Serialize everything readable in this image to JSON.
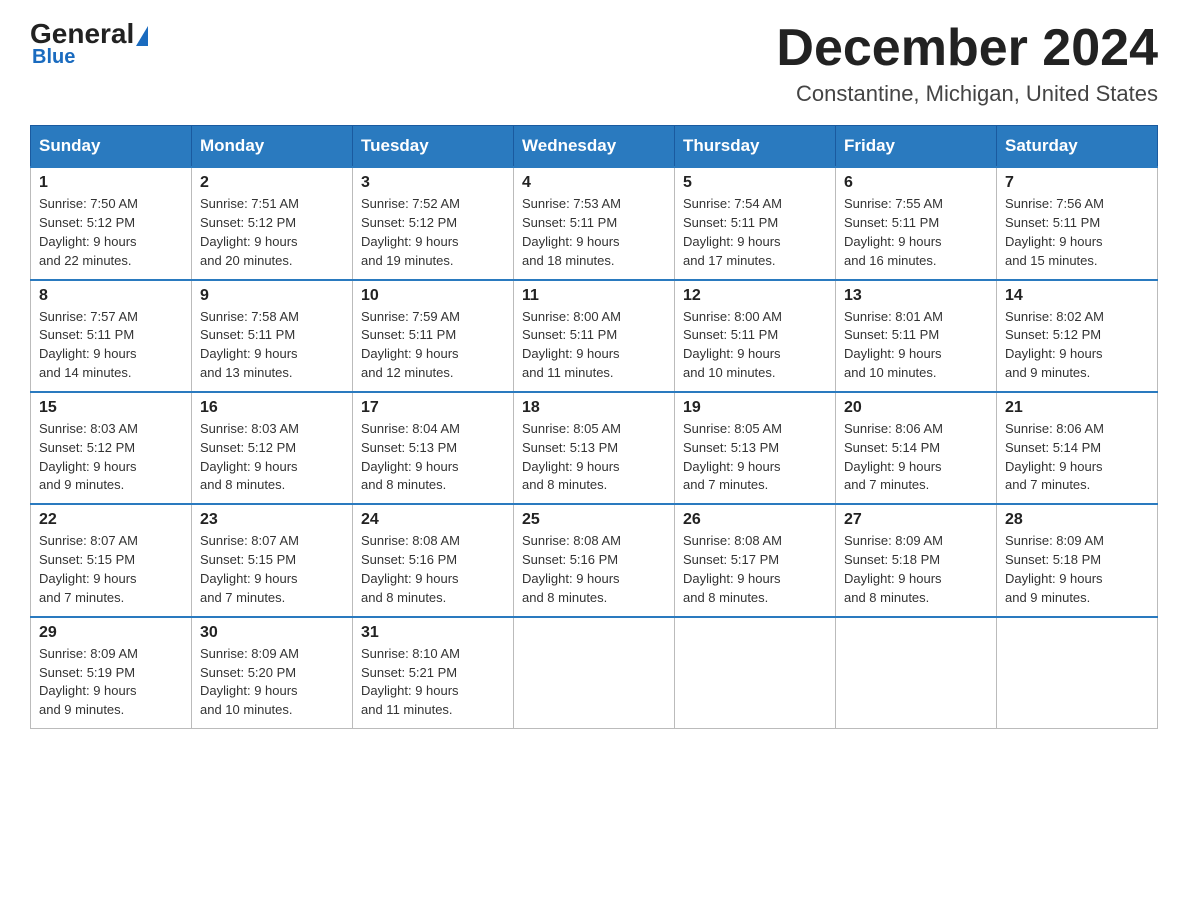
{
  "header": {
    "logo_general": "General",
    "logo_blue": "Blue",
    "main_title": "December 2024",
    "subtitle": "Constantine, Michigan, United States"
  },
  "days_of_week": [
    "Sunday",
    "Monday",
    "Tuesday",
    "Wednesday",
    "Thursday",
    "Friday",
    "Saturday"
  ],
  "weeks": [
    [
      {
        "day": "1",
        "sunrise": "Sunrise: 7:50 AM",
        "sunset": "Sunset: 5:12 PM",
        "daylight": "Daylight: 9 hours",
        "daylight2": "and 22 minutes."
      },
      {
        "day": "2",
        "sunrise": "Sunrise: 7:51 AM",
        "sunset": "Sunset: 5:12 PM",
        "daylight": "Daylight: 9 hours",
        "daylight2": "and 20 minutes."
      },
      {
        "day": "3",
        "sunrise": "Sunrise: 7:52 AM",
        "sunset": "Sunset: 5:12 PM",
        "daylight": "Daylight: 9 hours",
        "daylight2": "and 19 minutes."
      },
      {
        "day": "4",
        "sunrise": "Sunrise: 7:53 AM",
        "sunset": "Sunset: 5:11 PM",
        "daylight": "Daylight: 9 hours",
        "daylight2": "and 18 minutes."
      },
      {
        "day": "5",
        "sunrise": "Sunrise: 7:54 AM",
        "sunset": "Sunset: 5:11 PM",
        "daylight": "Daylight: 9 hours",
        "daylight2": "and 17 minutes."
      },
      {
        "day": "6",
        "sunrise": "Sunrise: 7:55 AM",
        "sunset": "Sunset: 5:11 PM",
        "daylight": "Daylight: 9 hours",
        "daylight2": "and 16 minutes."
      },
      {
        "day": "7",
        "sunrise": "Sunrise: 7:56 AM",
        "sunset": "Sunset: 5:11 PM",
        "daylight": "Daylight: 9 hours",
        "daylight2": "and 15 minutes."
      }
    ],
    [
      {
        "day": "8",
        "sunrise": "Sunrise: 7:57 AM",
        "sunset": "Sunset: 5:11 PM",
        "daylight": "Daylight: 9 hours",
        "daylight2": "and 14 minutes."
      },
      {
        "day": "9",
        "sunrise": "Sunrise: 7:58 AM",
        "sunset": "Sunset: 5:11 PM",
        "daylight": "Daylight: 9 hours",
        "daylight2": "and 13 minutes."
      },
      {
        "day": "10",
        "sunrise": "Sunrise: 7:59 AM",
        "sunset": "Sunset: 5:11 PM",
        "daylight": "Daylight: 9 hours",
        "daylight2": "and 12 minutes."
      },
      {
        "day": "11",
        "sunrise": "Sunrise: 8:00 AM",
        "sunset": "Sunset: 5:11 PM",
        "daylight": "Daylight: 9 hours",
        "daylight2": "and 11 minutes."
      },
      {
        "day": "12",
        "sunrise": "Sunrise: 8:00 AM",
        "sunset": "Sunset: 5:11 PM",
        "daylight": "Daylight: 9 hours",
        "daylight2": "and 10 minutes."
      },
      {
        "day": "13",
        "sunrise": "Sunrise: 8:01 AM",
        "sunset": "Sunset: 5:11 PM",
        "daylight": "Daylight: 9 hours",
        "daylight2": "and 10 minutes."
      },
      {
        "day": "14",
        "sunrise": "Sunrise: 8:02 AM",
        "sunset": "Sunset: 5:12 PM",
        "daylight": "Daylight: 9 hours",
        "daylight2": "and 9 minutes."
      }
    ],
    [
      {
        "day": "15",
        "sunrise": "Sunrise: 8:03 AM",
        "sunset": "Sunset: 5:12 PM",
        "daylight": "Daylight: 9 hours",
        "daylight2": "and 9 minutes."
      },
      {
        "day": "16",
        "sunrise": "Sunrise: 8:03 AM",
        "sunset": "Sunset: 5:12 PM",
        "daylight": "Daylight: 9 hours",
        "daylight2": "and 8 minutes."
      },
      {
        "day": "17",
        "sunrise": "Sunrise: 8:04 AM",
        "sunset": "Sunset: 5:13 PM",
        "daylight": "Daylight: 9 hours",
        "daylight2": "and 8 minutes."
      },
      {
        "day": "18",
        "sunrise": "Sunrise: 8:05 AM",
        "sunset": "Sunset: 5:13 PM",
        "daylight": "Daylight: 9 hours",
        "daylight2": "and 8 minutes."
      },
      {
        "day": "19",
        "sunrise": "Sunrise: 8:05 AM",
        "sunset": "Sunset: 5:13 PM",
        "daylight": "Daylight: 9 hours",
        "daylight2": "and 7 minutes."
      },
      {
        "day": "20",
        "sunrise": "Sunrise: 8:06 AM",
        "sunset": "Sunset: 5:14 PM",
        "daylight": "Daylight: 9 hours",
        "daylight2": "and 7 minutes."
      },
      {
        "day": "21",
        "sunrise": "Sunrise: 8:06 AM",
        "sunset": "Sunset: 5:14 PM",
        "daylight": "Daylight: 9 hours",
        "daylight2": "and 7 minutes."
      }
    ],
    [
      {
        "day": "22",
        "sunrise": "Sunrise: 8:07 AM",
        "sunset": "Sunset: 5:15 PM",
        "daylight": "Daylight: 9 hours",
        "daylight2": "and 7 minutes."
      },
      {
        "day": "23",
        "sunrise": "Sunrise: 8:07 AM",
        "sunset": "Sunset: 5:15 PM",
        "daylight": "Daylight: 9 hours",
        "daylight2": "and 7 minutes."
      },
      {
        "day": "24",
        "sunrise": "Sunrise: 8:08 AM",
        "sunset": "Sunset: 5:16 PM",
        "daylight": "Daylight: 9 hours",
        "daylight2": "and 8 minutes."
      },
      {
        "day": "25",
        "sunrise": "Sunrise: 8:08 AM",
        "sunset": "Sunset: 5:16 PM",
        "daylight": "Daylight: 9 hours",
        "daylight2": "and 8 minutes."
      },
      {
        "day": "26",
        "sunrise": "Sunrise: 8:08 AM",
        "sunset": "Sunset: 5:17 PM",
        "daylight": "Daylight: 9 hours",
        "daylight2": "and 8 minutes."
      },
      {
        "day": "27",
        "sunrise": "Sunrise: 8:09 AM",
        "sunset": "Sunset: 5:18 PM",
        "daylight": "Daylight: 9 hours",
        "daylight2": "and 8 minutes."
      },
      {
        "day": "28",
        "sunrise": "Sunrise: 8:09 AM",
        "sunset": "Sunset: 5:18 PM",
        "daylight": "Daylight: 9 hours",
        "daylight2": "and 9 minutes."
      }
    ],
    [
      {
        "day": "29",
        "sunrise": "Sunrise: 8:09 AM",
        "sunset": "Sunset: 5:19 PM",
        "daylight": "Daylight: 9 hours",
        "daylight2": "and 9 minutes."
      },
      {
        "day": "30",
        "sunrise": "Sunrise: 8:09 AM",
        "sunset": "Sunset: 5:20 PM",
        "daylight": "Daylight: 9 hours",
        "daylight2": "and 10 minutes."
      },
      {
        "day": "31",
        "sunrise": "Sunrise: 8:10 AM",
        "sunset": "Sunset: 5:21 PM",
        "daylight": "Daylight: 9 hours",
        "daylight2": "and 11 minutes."
      },
      null,
      null,
      null,
      null
    ]
  ]
}
